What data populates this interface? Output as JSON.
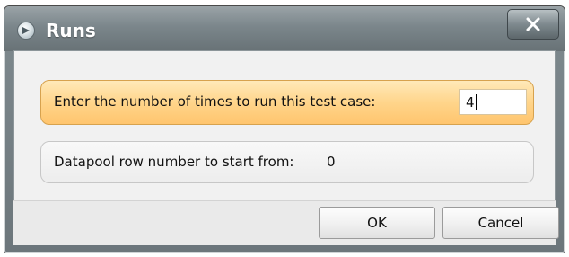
{
  "window": {
    "title": "Runs"
  },
  "icons": {
    "app": "app-icon",
    "close": "close-icon"
  },
  "fields": [
    {
      "label": "Enter the number of times to run this test case:",
      "value": "4"
    },
    {
      "label": "Datapool row number to start from:",
      "value": "0"
    }
  ],
  "buttons": {
    "ok": "OK",
    "cancel": "Cancel"
  },
  "colors": {
    "titlebar": "#7b868b",
    "active_field": "#ffd58b",
    "dialog_background": "#f1f1f1"
  }
}
